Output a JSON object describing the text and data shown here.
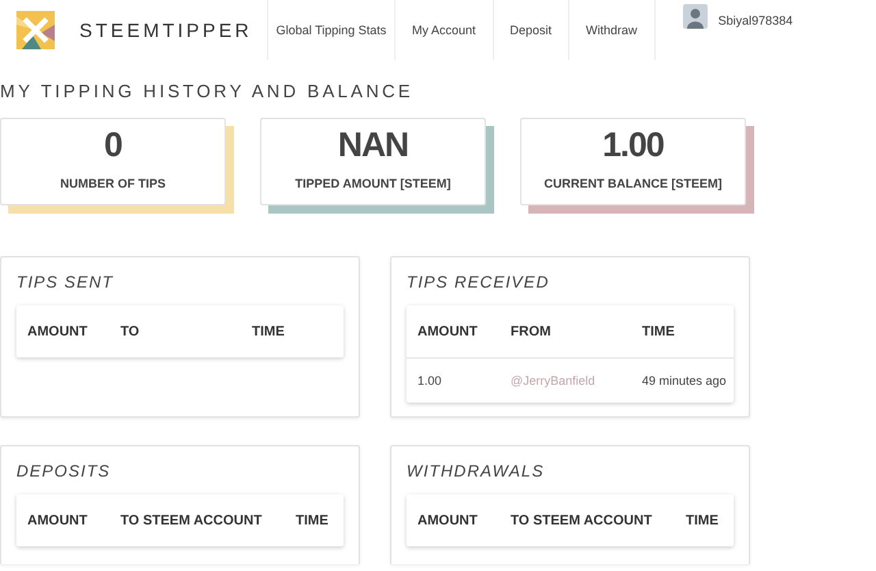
{
  "header": {
    "brand": "STEEMTIPPER",
    "nav": [
      {
        "label": "Global Tipping Stats"
      },
      {
        "label": "My Account"
      },
      {
        "label": "Deposit"
      },
      {
        "label": "Withdraw"
      }
    ],
    "user": {
      "name": "Sbiyal978384"
    }
  },
  "page_title": "MY TIPPING HISTORY AND BALANCE",
  "stats": [
    {
      "value": "0",
      "label": "NUMBER OF TIPS",
      "color": "#f6dfa8"
    },
    {
      "value": "NAN",
      "label": "TIPPED AMOUNT [STEEM]",
      "color": "#a9c6c4"
    },
    {
      "value": "1.00",
      "label": "CURRENT BALANCE [STEEM]",
      "color": "#d6b4b8"
    }
  ],
  "panels": [
    {
      "title": "TIPS SENT",
      "columns": [
        "AMOUNT",
        "TO",
        "TIME"
      ]
    },
    {
      "title": "TIPS RECEIVED",
      "columns": [
        "AMOUNT",
        "FROM",
        "TIME"
      ],
      "rows": [
        [
          {
            "text": "1.00",
            "kind": "text"
          },
          {
            "text": "@JerryBanfield",
            "kind": "link"
          },
          {
            "text": "49 minutes ago",
            "kind": "text"
          }
        ]
      ]
    },
    {
      "title": "DEPOSITS",
      "columns": [
        "AMOUNT",
        "TO STEEM ACCOUNT",
        "TIME"
      ]
    },
    {
      "title": "WITHDRAWALS",
      "columns": [
        "AMOUNT",
        "TO STEEM ACCOUNT",
        "TIME"
      ]
    }
  ]
}
